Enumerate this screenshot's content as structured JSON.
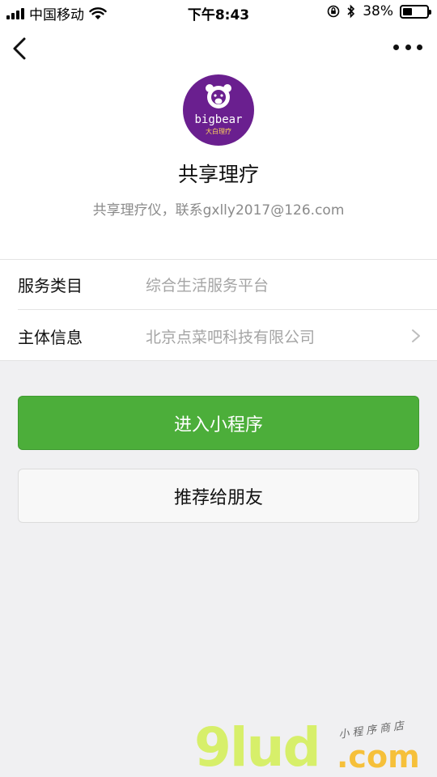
{
  "status_bar": {
    "carrier": "中国移动",
    "time": "下午8:43",
    "battery": "38%",
    "battery_level": 0.38
  },
  "header": {
    "back_icon": "chevron-left-icon",
    "more_icon": "more-dots-icon"
  },
  "profile": {
    "logo_text": "bigbear",
    "logo_subtext": "大白理疗",
    "logo_color": "#6a1f8f",
    "name": "共享理疗",
    "description": "共享理疗仪，联系gxlly2017@126.com"
  },
  "info": {
    "rows": [
      {
        "label": "服务类目",
        "value": "综合生活服务平台"
      },
      {
        "label": "主体信息",
        "value": "北京点菜吧科技有限公司"
      }
    ]
  },
  "actions": {
    "enter_label": "进入小程序",
    "share_label": "推荐给朋友",
    "accent": "#4cae3a"
  },
  "watermark": {
    "main": "9lud",
    "domain": ".com",
    "tag": "小程序商店"
  }
}
